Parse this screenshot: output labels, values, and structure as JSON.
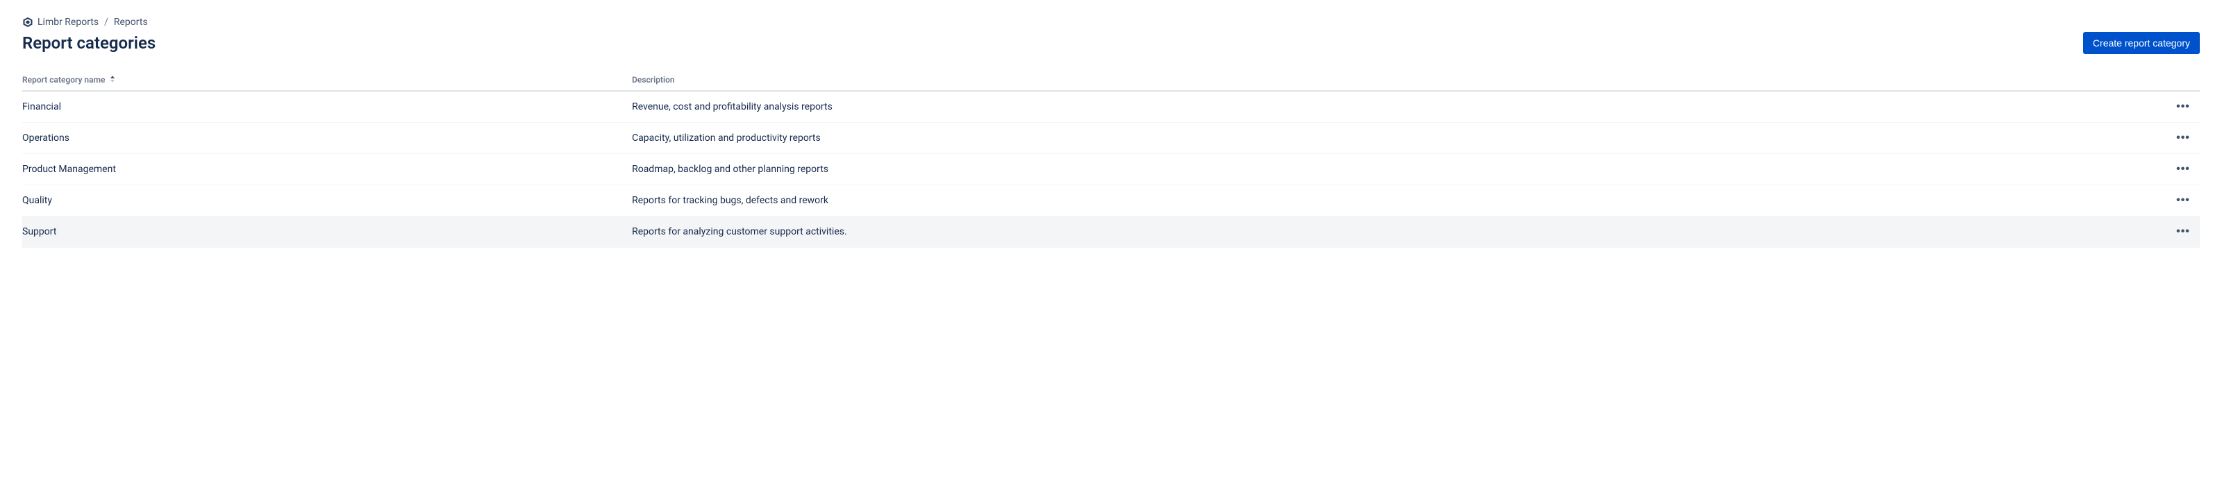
{
  "breadcrumb": {
    "root": "Limbr Reports",
    "current": "Reports"
  },
  "page": {
    "title": "Report categories",
    "create_button": "Create report category"
  },
  "table": {
    "headers": {
      "name": "Report category name",
      "description": "Description"
    },
    "rows": [
      {
        "name": "Financial",
        "description": "Revenue, cost and profitability analysis reports",
        "highlighted": false
      },
      {
        "name": "Operations",
        "description": "Capacity, utilization and productivity reports",
        "highlighted": false
      },
      {
        "name": "Product Management",
        "description": "Roadmap, backlog and other planning reports",
        "highlighted": false
      },
      {
        "name": "Quality",
        "description": "Reports for tracking bugs, defects and rework",
        "highlighted": false
      },
      {
        "name": "Support",
        "description": "Reports for analyzing customer support activities.",
        "highlighted": true
      }
    ]
  }
}
